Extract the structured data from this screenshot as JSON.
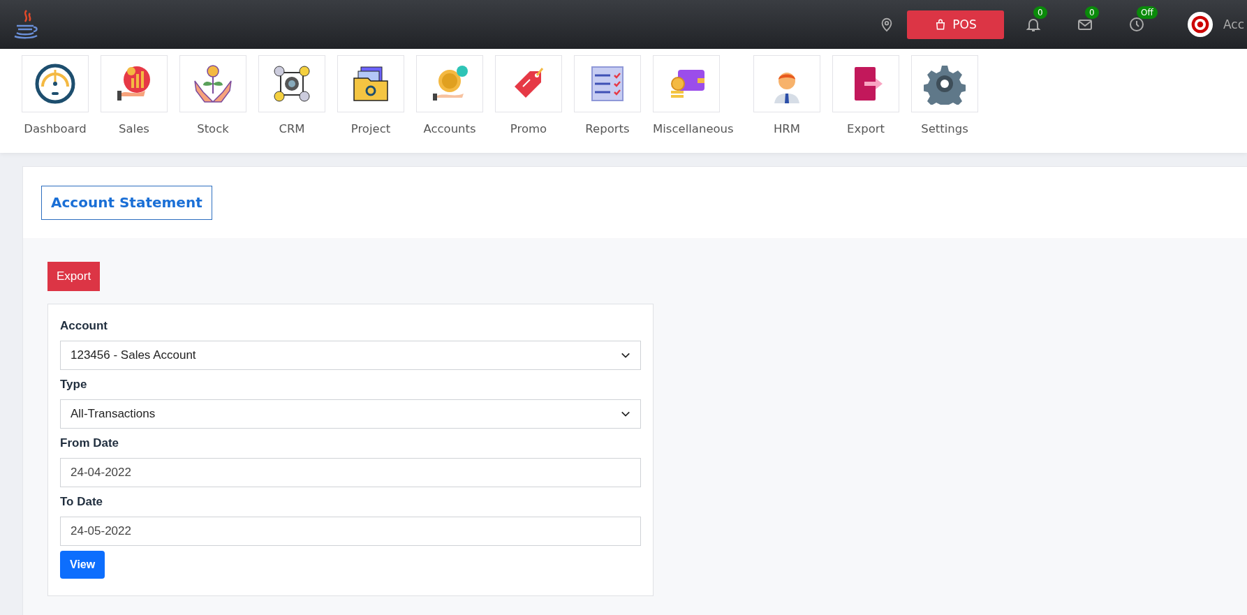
{
  "topbar": {
    "pos_label": "POS",
    "notifications": "0",
    "messages": "0",
    "clock_status": "Off",
    "user_name": "Acc"
  },
  "modules": [
    {
      "label": "Dashboard"
    },
    {
      "label": "Sales"
    },
    {
      "label": "Stock"
    },
    {
      "label": "CRM"
    },
    {
      "label": "Project"
    },
    {
      "label": "Accounts"
    },
    {
      "label": "Promo"
    },
    {
      "label": "Reports"
    },
    {
      "label": "Miscellaneous"
    },
    {
      "label": "HRM"
    },
    {
      "label": "Export"
    },
    {
      "label": "Settings"
    }
  ],
  "page": {
    "title": "Account Statement",
    "export_button": "Export",
    "fields": [
      {
        "label": "Account",
        "kind": "select",
        "value": "123456 - Sales Account"
      },
      {
        "label": "Type",
        "kind": "select",
        "value": "All-Transactions"
      },
      {
        "label": "From Date",
        "kind": "date",
        "value": "24-04-2022"
      },
      {
        "label": "To Date",
        "kind": "date",
        "value": "24-05-2022"
      }
    ],
    "view_button": "View"
  }
}
